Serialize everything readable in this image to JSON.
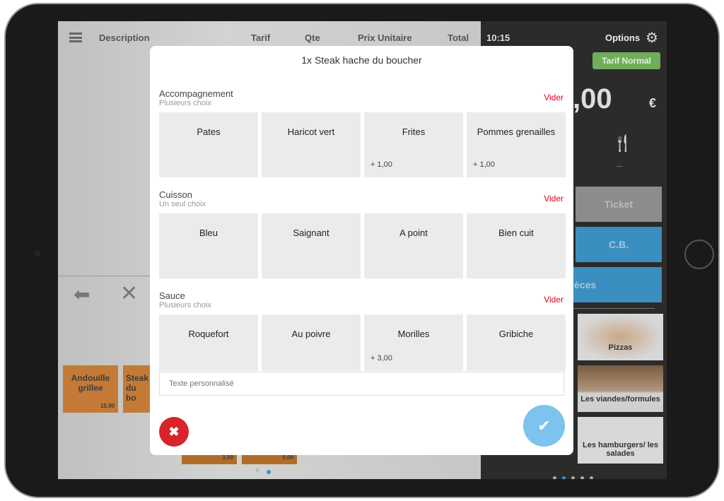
{
  "header": {
    "description": "Description",
    "tarif": "Tarif",
    "qte": "Qte",
    "prix_unitaire": "Prix Unitaire",
    "total": "Total"
  },
  "right_panel": {
    "time": "10:15",
    "options": "Options",
    "tarif_button": "Tarif Normal",
    "amount": ",00",
    "currency": "€",
    "dots": "...",
    "ticket": "Ticket",
    "cb": "C.B.",
    "especes": "èces"
  },
  "products": [
    {
      "name": "Andouille grillee",
      "price": "15,90"
    },
    {
      "name": "Steak du bo",
      "price": ""
    },
    {
      "name": "",
      "price": "3,50"
    },
    {
      "name": "",
      "price": "0,00"
    }
  ],
  "pager_letter": "F",
  "categories": [
    "Pizzas",
    "Les viandes/formules",
    "Les hamburgers/ les salades"
  ],
  "modal": {
    "title": "1x Steak hache du boucher",
    "clear_label": "Vider",
    "sections": [
      {
        "name": "Accompagnement",
        "hint": "Plusieurs choix",
        "options": [
          {
            "label": "Pates",
            "price": ""
          },
          {
            "label": "Haricot vert",
            "price": ""
          },
          {
            "label": "Frites",
            "price": "+ 1,00"
          },
          {
            "label": "Pommes grenailles",
            "price": "+ 1,00"
          }
        ]
      },
      {
        "name": "Cuisson",
        "hint": "Un seul choix",
        "options": [
          {
            "label": "Bleu",
            "price": ""
          },
          {
            "label": "Saignant",
            "price": ""
          },
          {
            "label": "A point",
            "price": ""
          },
          {
            "label": "Bien cuit",
            "price": ""
          }
        ]
      },
      {
        "name": "Sauce",
        "hint": "Plusieurs choix",
        "options": [
          {
            "label": "Roquefort",
            "price": ""
          },
          {
            "label": "Au poivre",
            "price": ""
          },
          {
            "label": "Morilles",
            "price": "+ 3,00"
          },
          {
            "label": "Gribiche",
            "price": ""
          }
        ]
      }
    ],
    "custom_text_placeholder": "Texte personnalisé"
  },
  "colors": {
    "accent_blue": "#7cc4ee",
    "cancel_red": "#d8232a",
    "vider_red": "#e0001b",
    "tarif_green": "#6fae5a"
  }
}
